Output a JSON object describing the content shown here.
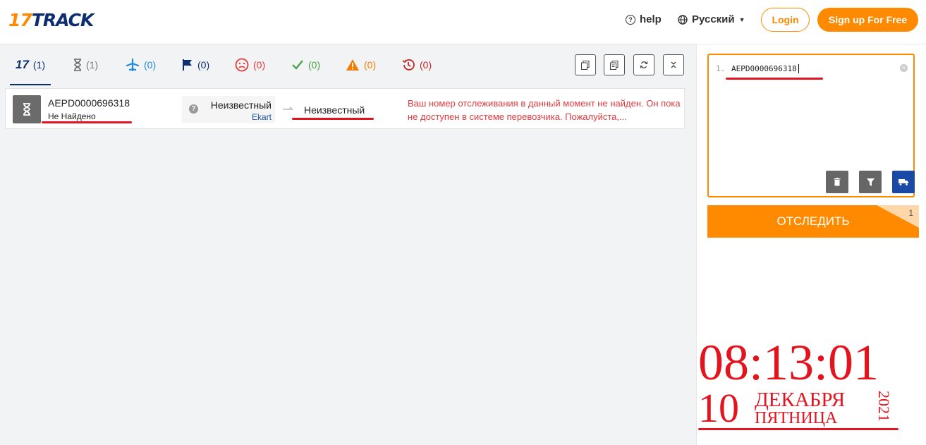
{
  "header": {
    "logo_num": "17",
    "logo_text": "TRACK",
    "help_label": "help",
    "lang_label": "Русский",
    "login_label": "Login",
    "signup_label": "Sign up For Free"
  },
  "tabs": [
    {
      "name": "all",
      "count": "(1)",
      "color": "#0d2f6f"
    },
    {
      "name": "not-found",
      "count": "(1)",
      "color": "#666666"
    },
    {
      "name": "in-transit",
      "count": "(0)",
      "color": "#1e88e5"
    },
    {
      "name": "pick-up",
      "count": "(0)",
      "color": "#0d2f6f"
    },
    {
      "name": "undelivered",
      "count": "(0)",
      "color": "#e53935"
    },
    {
      "name": "delivered",
      "count": "(0)",
      "color": "#43a047"
    },
    {
      "name": "alert",
      "count": "(0)",
      "color": "#f57c00"
    },
    {
      "name": "expired",
      "count": "(0)",
      "color": "#c62828"
    }
  ],
  "result": {
    "tracking_number": "AEPD0000696318",
    "status": "Не Найдено",
    "origin": "Неизвестный",
    "carrier": "Ekart",
    "destination": "Неизвестный",
    "message": "Ваш номер отслеживания в данный момент не найден. Он пока не доступен в системе перевозчика. Пожалуйста,..."
  },
  "tracker": {
    "line_number": "1.",
    "input_value": "AEPD0000696318",
    "track_button": "ОТСЛЕДИТЬ",
    "count": "1"
  },
  "clock": {
    "time": "08:13:01",
    "day": "10",
    "month": "ДЕКАБРЯ",
    "weekday": "ПЯТНИЦА",
    "year": "2021"
  },
  "colors": {
    "accent": "#ff8a00",
    "brand": "#0d2f6f",
    "error": "#e0393e",
    "annotation": "#e3141e"
  }
}
